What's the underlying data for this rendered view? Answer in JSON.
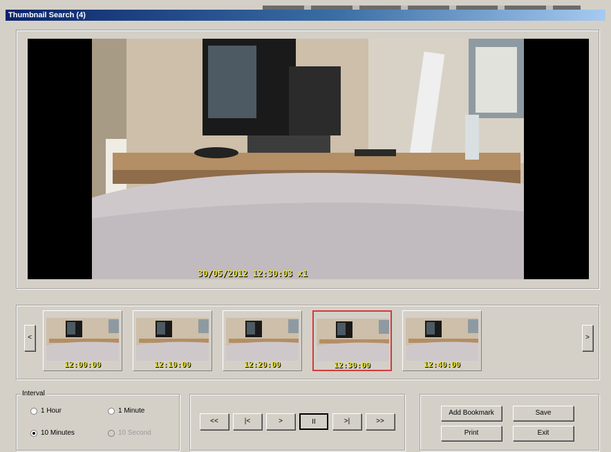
{
  "window": {
    "title": "Thumbnail Search (4)"
  },
  "video": {
    "osd": "30/05/2012 12:30:03 x1"
  },
  "thumbnails": {
    "prev_label": "<",
    "next_label": ">",
    "items": [
      {
        "time": "12:00:00",
        "selected": false
      },
      {
        "time": "12:10:00",
        "selected": false
      },
      {
        "time": "12:20:00",
        "selected": false
      },
      {
        "time": "12:30:00",
        "selected": true
      },
      {
        "time": "12:40:00",
        "selected": false
      }
    ]
  },
  "interval": {
    "legend": "Interval",
    "options": [
      {
        "label": "1 Hour",
        "checked": false,
        "disabled": false
      },
      {
        "label": "1 Minute",
        "checked": false,
        "disabled": false
      },
      {
        "label": "10 Minutes",
        "checked": true,
        "disabled": false
      },
      {
        "label": "10 Second",
        "checked": false,
        "disabled": true
      }
    ]
  },
  "playback": {
    "buttons": [
      "<<",
      "|<",
      ">",
      "II",
      ">|",
      ">>"
    ],
    "pressed_index": 3
  },
  "actions": {
    "add_bookmark": "Add Bookmark",
    "save": "Save",
    "print": "Print",
    "exit": "Exit"
  },
  "colors": {
    "title_bar": "#0a246a",
    "osd_text": "#e6e23a",
    "selection_border": "#d23b3b",
    "window_bg": "#d4d0c8"
  }
}
